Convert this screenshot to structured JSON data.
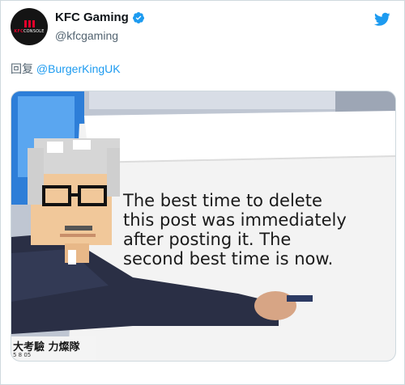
{
  "tweet": {
    "author": {
      "display_name": "KFC Gaming",
      "handle": "@kfcgaming",
      "verified": true,
      "avatar_logo_text_red": "KFC",
      "avatar_logo_text_white": "CONSOLE"
    },
    "reply": {
      "prefix": "回复",
      "mention": "@BurgerKingUK"
    },
    "media": {
      "meme_text": "The best time to delete\nthis post was immediately\nafter posting it. The\nsecond best time is now.",
      "caption_main": "大考驗 力燦隊",
      "caption_sub": "5 8 05"
    }
  },
  "colors": {
    "accent": "#1d9bf0",
    "text_primary": "#0f1419",
    "text_secondary": "#536471",
    "border": "#cfd9de"
  },
  "icons": {
    "verified": "verified-badge-icon",
    "brand": "twitter-bird-icon"
  }
}
